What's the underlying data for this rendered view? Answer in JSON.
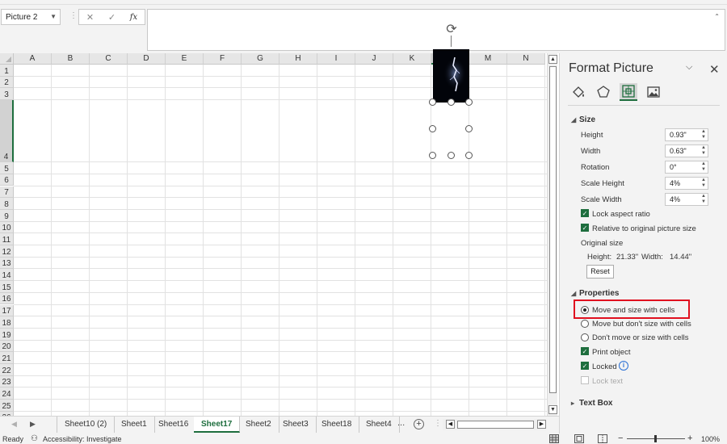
{
  "formula_bar": {
    "name_box": "Picture 2",
    "fx_label": "fx",
    "cancel_glyph": "✕",
    "enter_glyph": "✓",
    "formula_value": ""
  },
  "grid": {
    "columns": [
      "A",
      "B",
      "C",
      "D",
      "E",
      "F",
      "G",
      "H",
      "I",
      "J",
      "K",
      "L",
      "M",
      "N"
    ],
    "rows": [
      "1",
      "2",
      "3",
      "4",
      "5",
      "6",
      "7",
      "8",
      "9",
      "10",
      "11",
      "12",
      "13",
      "14",
      "15",
      "16",
      "17",
      "18",
      "19",
      "20",
      "21",
      "22",
      "23",
      "24",
      "25",
      "26"
    ]
  },
  "sheet_tabs": {
    "tabs": [
      "Sheet10 (2)",
      "Sheet1",
      "Sheet16",
      "Sheet17",
      "Sheet2",
      "Sheet3",
      "Sheet18",
      "Sheet4"
    ],
    "active": "Sheet17",
    "more": "..."
  },
  "status_bar": {
    "ready": "Ready",
    "accessibility": "Accessibility: Investigate",
    "zoom": "100%"
  },
  "panel": {
    "title": "Format Picture",
    "size_section": {
      "title": "Size",
      "height_label": "Height",
      "height_value": "0.93\"",
      "width_label": "Width",
      "width_value": "0.63\"",
      "rotation_label": "Rotation",
      "rotation_value": "0°",
      "scale_height_label": "Scale Height",
      "scale_height_value": "4%",
      "scale_width_label": "Scale Width",
      "scale_width_value": "4%",
      "lock_aspect": "Lock aspect ratio",
      "relative_original": "Relative to original picture size",
      "original_size_label": "Original size",
      "original_height_label": "Height:",
      "original_height_value": "21.33\"",
      "original_width_label": "Width:",
      "original_width_value": "14.44\"",
      "reset": "Reset"
    },
    "properties_section": {
      "title": "Properties",
      "move_and_size": "Move and size with cells",
      "move_no_size": "Move but don't size with cells",
      "dont_move": "Don't move or size with cells",
      "print_object": "Print object",
      "locked": "Locked",
      "lock_text": "Lock text"
    },
    "textbox_section": {
      "title": "Text Box"
    }
  },
  "colors": {
    "accent": "#1e6e3e",
    "highlight": "#e0101f"
  }
}
